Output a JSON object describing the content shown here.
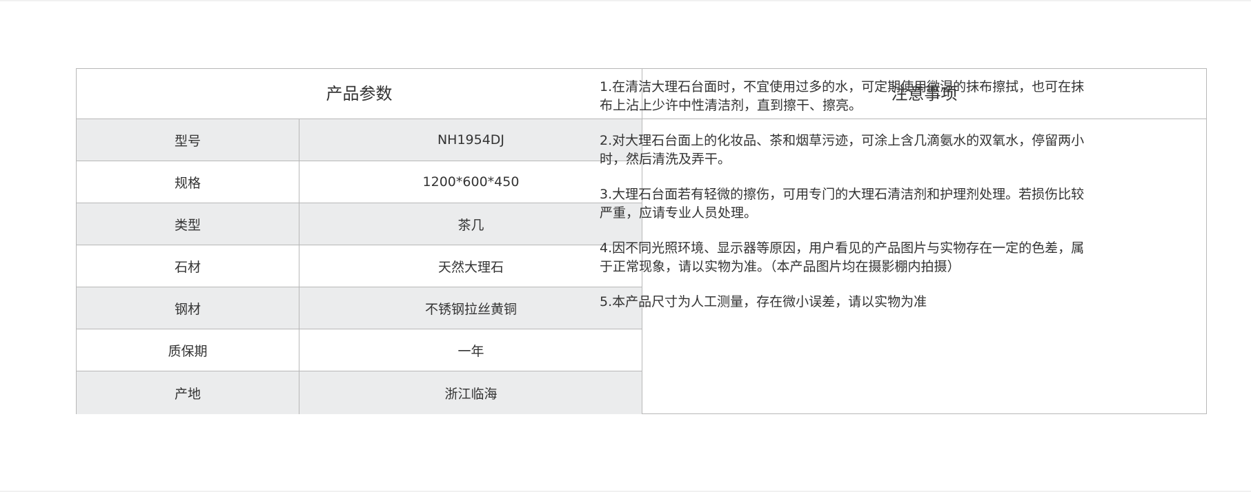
{
  "params_heading": "产品参数",
  "notes_heading": "注意事项",
  "params": [
    {
      "key": "型号",
      "value": "NH1954DJ"
    },
    {
      "key": "规格",
      "value": "1200*600*450"
    },
    {
      "key": "类型",
      "value": "茶几"
    },
    {
      "key": "石材",
      "value": "天然大理石"
    },
    {
      "key": "钢材",
      "value": "不锈钢拉丝黄铜"
    },
    {
      "key": "质保期",
      "value": "一年"
    },
    {
      "key": "产地",
      "value": "浙江临海"
    }
  ],
  "notes": [
    "1.在清洁大理石台面时，不宜使用过多的水，可定期使用微湿的抹布擦拭，也可在抹布上沾上少许中性清洁剂，直到擦干、擦亮。",
    "2.对大理石台面上的化妆品、茶和烟草污迹，可涂上含几滴氨水的双氧水，停留两小时，然后清洗及弄干。",
    "3.大理石台面若有轻微的擦伤，可用专门的大理石清洁剂和护理剂处理。若损伤比较严重，应请专业人员处理。",
    "4.因不同光照环境、显示器等原因，用户看见的产品图片与实物存在一定的色差，属于正常现象，请以实物为准。（本产品图片均在摄影棚内拍摄）",
    "5.本产品尺寸为人工测量，存在微小误差，请以实物为准"
  ],
  "colors": {
    "border": "#b7b7b7",
    "row_shade": "#ebeced",
    "text": "#333333"
  }
}
